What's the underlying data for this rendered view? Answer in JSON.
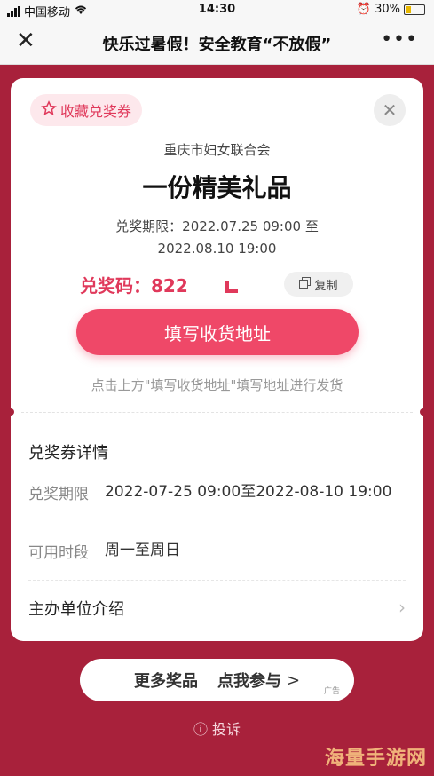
{
  "status_bar": {
    "carrier": "中国移动",
    "time": "14:30",
    "battery": "30%"
  },
  "nav": {
    "title": "快乐过暑假！安全教育“不放假”"
  },
  "coupon": {
    "favorite_label": "收藏兑奖券",
    "organizer": "重庆市妇女联合会",
    "prize": "一份精美礼品",
    "period_line1": "兑奖期限：2022.07.25 09:00 至",
    "period_line2": "2022.08.10 19:00",
    "code_label": "兑奖码：",
    "code_value": "822",
    "copy_label": "复制",
    "fill_address_button": "填写收货地址",
    "hint": "点击上方\"填写收货地址\"填写地址进行发货"
  },
  "details": {
    "title": "兑奖券详情",
    "rows": [
      {
        "key": "兑奖期限",
        "value": "2022-07-25 09:00至2022-08-10 19:00"
      },
      {
        "key": "可用时段",
        "value": "周一至周日"
      }
    ],
    "sponsor_label": "主办单位介绍"
  },
  "footer": {
    "more_prizes_left": "更多奖品",
    "more_prizes_right": "点我参与",
    "ad_label": "广告",
    "complain": "投诉"
  },
  "watermark": "海量手游网",
  "colors": {
    "background": "#a8213b",
    "accent": "#ef4868"
  }
}
